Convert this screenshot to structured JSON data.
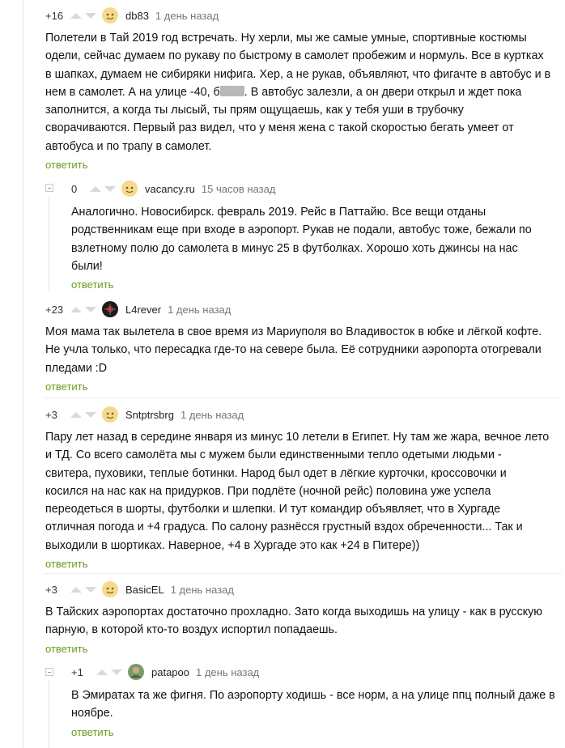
{
  "reply_label": "ответить",
  "accent_reply_color": "#6a9a1a",
  "comments": [
    {
      "rating": "+16",
      "author": "db83",
      "time": "1 день назад",
      "avatar_icon": "smile-avatar-icon",
      "lines": [
        "Полетели в Тай 2019 год встречать. Ну херли, мы же самые умные, спортивные костюмы",
        "одели, сейчас думаем по рукаву по быстрому в самолет пробежим и нормуль. Все в куртках",
        "в шапках, думаем не сибиряки нифига. Хер, а не рукав, объявляют, что фигачте в автобус и в",
        "нем в самолет. А на улице -40, б",
        ". В автобус залезли, а он двери открыл и ждет пока",
        "заполнится, а когда ты лысый, ты прям ощущаешь, как у тебя уши в трубочку",
        "сворачиваются. Первый раз видел, что у меня жена с такой скоростью бегать умеет от",
        "автобуса и по трапу в самолет."
      ]
    },
    {
      "rating": "0",
      "author": "vacancy.ru",
      "time": "15 часов назад",
      "avatar_icon": "smile-avatar-icon",
      "lines": [
        "Аналогично. Новосибирск. февраль 2019. Рейс в Паттайю. Все вещи отданы",
        "родственникам еще при входе в аэропорт. Рукав не подали, автобус тоже, бежали по",
        "взлетному полю до самолета в минус 25 в футболках. Хорошо хоть джинсы на нас",
        "были!"
      ]
    },
    {
      "rating": "+23",
      "author": "L4rever",
      "time": "1 день назад",
      "avatar_icon": "dark-avatar-icon",
      "lines": [
        "Моя мама так вылетела в свое время из Мариуполя во Владивосток в юбке и лёгкой кофте.",
        "Не учла только, что пересадка где-то на севере была. Её сотрудники аэропорта отогревали",
        "пледами :D"
      ]
    },
    {
      "rating": "+3",
      "author": "Sntptrsbrg",
      "time": "1 день назад",
      "avatar_icon": "smile-avatar-icon",
      "lines": [
        "Пару лет назад в середине января из минус 10 летели в Египет. Ну там же жара, вечное лето",
        "и ТД. Со всего самолёта мы с мужем были единственными тепло одетыми людьми -",
        "свитера, пуховики, теплые ботинки. Народ был одет в лёгкие курточки, кроссовочки и",
        "косился на нас как на придурков. При подлёте (ночной рейс) половина уже успела",
        "переодеться в шорты, футболки и шлепки. И тут командир объявляет, что в Хургаде",
        "отличная погода и +4 градуса. По салону разнёсся грустный вздох обреченности... Так и",
        "выходили в шортиках. Наверное, +4 в Хургаде это как +24 в Питере))"
      ]
    },
    {
      "rating": "+3",
      "author": "BasicEL",
      "time": "1 день назад",
      "avatar_icon": "smile-avatar-icon",
      "lines": [
        "В Тайских аэропортах достаточно прохладно. Зато когда выходишь на улицу - как в русскую",
        "парную, в которой кто-то воздух испортил попадаешь."
      ]
    },
    {
      "rating": "+1",
      "author": "patapoo",
      "time": "1 день назад",
      "avatar_icon": "photo-avatar-icon",
      "lines": [
        "В Эмиратах та же фигня. По аэропорту ходишь - все норм, а на улице ппц полный даже в",
        "ноябре."
      ]
    }
  ]
}
